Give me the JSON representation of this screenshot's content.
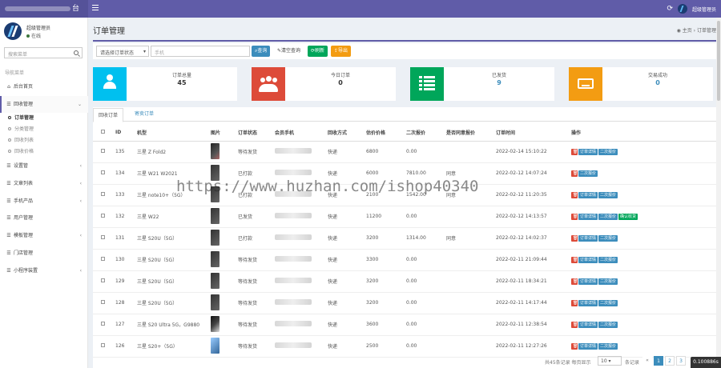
{
  "brand": {
    "text": "台"
  },
  "topbar": {
    "admin_name": "超级管理员"
  },
  "user": {
    "name": "超级管理员",
    "status": "在线"
  },
  "sidebar": {
    "search_placeholder": "搜索菜单",
    "nav_header": "导航菜单",
    "items": [
      {
        "label": "后台首页",
        "icon": "home-icon"
      },
      {
        "label": "回收管理",
        "icon": "list-icon",
        "expanded": true
      },
      {
        "label": "设置管",
        "icon": "list-icon"
      },
      {
        "label": "文章列表",
        "icon": "list-icon"
      },
      {
        "label": "手机产品",
        "icon": "list-icon"
      },
      {
        "label": "用户管理",
        "icon": "list-icon"
      },
      {
        "label": "模板管理",
        "icon": "list-icon"
      },
      {
        "label": "门店管理",
        "icon": "list-icon"
      },
      {
        "label": "小程序装置",
        "icon": "list-icon"
      }
    ],
    "sub_items": [
      {
        "label": "订单管理",
        "active": true
      },
      {
        "label": "分类管理"
      },
      {
        "label": "回收列表"
      },
      {
        "label": "回收价格"
      }
    ]
  },
  "page": {
    "title": "订单管理",
    "breadcrumb_home": "主页",
    "breadcrumb_current": "订单管理"
  },
  "filter": {
    "status_select": "请选择订单状态",
    "keyword_placeholder": "手机",
    "query_label": "查询",
    "reset_label": "清空查询",
    "refresh_label": "刷新",
    "export_label": "导出"
  },
  "stats": [
    {
      "label": "订单总量",
      "value": "45",
      "color": "#00c0ef",
      "icon": "user-icon"
    },
    {
      "label": "今日订单",
      "value": "0",
      "color": "#dd4b39",
      "icon": "users-icon"
    },
    {
      "label": "已发货",
      "value": "9",
      "color": "#00a65a",
      "icon": "list-icon"
    },
    {
      "label": "交易成功",
      "value": "0",
      "color": "#f39c12",
      "icon": "keyboard-icon"
    }
  ],
  "tabs": [
    {
      "label": "回收订单"
    },
    {
      "label": "寄卖订单"
    }
  ],
  "table": {
    "headers": [
      "",
      "ID",
      "机型",
      "图片",
      "订单状态",
      "会员手机",
      "回收方式",
      "估价价格",
      "二次报价",
      "是否同意报价",
      "订单时间",
      "操作"
    ],
    "action_labels": {
      "detail": "订单详情",
      "second": "二次报价",
      "confirm": "确认收货"
    },
    "rows": [
      {
        "id": "135",
        "model": "三星 Z Fold2",
        "status": "等待发货",
        "method": "快递",
        "price": "6800",
        "second": "0.00",
        "agree": "",
        "time": "2022-02-14 15:10:22",
        "detail": true,
        "second_btn": true,
        "confirm_btn": false
      },
      {
        "id": "134",
        "model": "三星 W21 W2021",
        "status": "已打款",
        "method": "快递",
        "price": "6000",
        "second": "7810.00",
        "agree": "同意",
        "time": "2022-02-12 14:07:24",
        "detail": false,
        "second_btn": true,
        "confirm_btn": false
      },
      {
        "id": "133",
        "model": "三星 note10+（5G）",
        "status": "已打款",
        "method": "快递",
        "price": "2100",
        "second": "1542.00",
        "agree": "同意",
        "time": "2022-02-12 11:20:35",
        "detail": true,
        "second_btn": true,
        "confirm_btn": false
      },
      {
        "id": "132",
        "model": "三星 W22",
        "status": "已发货",
        "method": "快递",
        "price": "11200",
        "second": "0.00",
        "agree": "",
        "time": "2022-02-12 14:13:57",
        "detail": true,
        "second_btn": true,
        "confirm_btn": true
      },
      {
        "id": "131",
        "model": "三星 S20U（5G）",
        "status": "已打款",
        "method": "快递",
        "price": "3200",
        "second": "1314.00",
        "agree": "同意",
        "time": "2022-02-12 14:02:37",
        "detail": true,
        "second_btn": true,
        "confirm_btn": false
      },
      {
        "id": "130",
        "model": "三星 S20U（5G）",
        "status": "等待发货",
        "method": "快递",
        "price": "3300",
        "second": "0.00",
        "agree": "",
        "time": "2022-02-11 21:09:44",
        "detail": true,
        "second_btn": true,
        "confirm_btn": false
      },
      {
        "id": "129",
        "model": "三星 S20U（5G）",
        "status": "等待发货",
        "method": "快递",
        "price": "3200",
        "second": "0.00",
        "agree": "",
        "time": "2022-02-11 18:34:21",
        "detail": true,
        "second_btn": true,
        "confirm_btn": false
      },
      {
        "id": "128",
        "model": "三星 S20U（5G）",
        "status": "等待发货",
        "method": "快递",
        "price": "3200",
        "second": "0.00",
        "agree": "",
        "time": "2022-02-11 14:17:44",
        "detail": true,
        "second_btn": true,
        "confirm_btn": false
      },
      {
        "id": "127",
        "model": "三星 S20 Ultra 5G，G9880",
        "status": "等待发货",
        "method": "快递",
        "price": "3600",
        "second": "0.00",
        "agree": "",
        "time": "2022-02-11 12:38:54",
        "detail": true,
        "second_btn": true,
        "confirm_btn": false
      },
      {
        "id": "126",
        "model": "三星 S20+（5G）",
        "status": "等待发货",
        "method": "快递",
        "price": "2500",
        "second": "0.00",
        "agree": "",
        "time": "2022-02-11 12:27:26",
        "detail": true,
        "second_btn": true,
        "confirm_btn": false
      }
    ]
  },
  "pagination": {
    "info": "共45条记录 每页显示",
    "per_page": "10",
    "after": "条记录",
    "prev": "«",
    "pages": [
      "1",
      "2",
      "3"
    ],
    "current": "1"
  },
  "timer": "0.100886s",
  "watermark": "https://www.huzhan.com/ishop40340"
}
